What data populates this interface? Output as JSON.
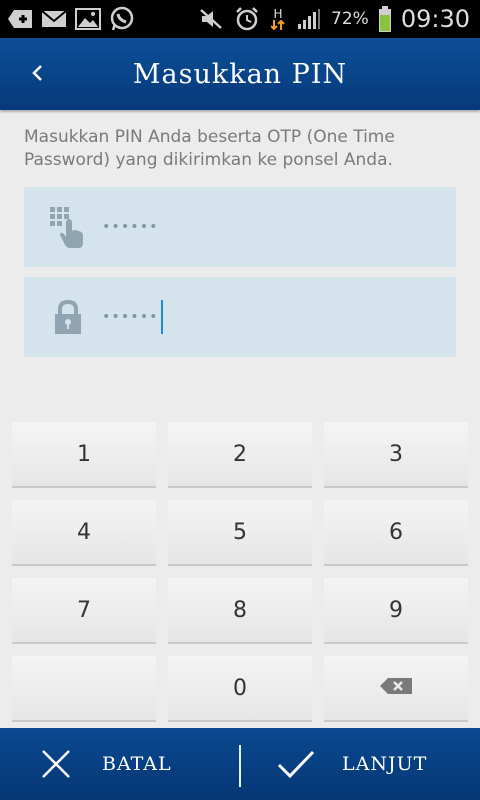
{
  "status_bar": {
    "battery_percent": "72%",
    "time": "09:30",
    "network_type": "H",
    "icons": [
      "plus-notification-icon",
      "email-icon",
      "gallery-icon",
      "whatsapp-icon",
      "mute-icon",
      "alarm-icon",
      "data-transfer-icon",
      "signal-icon",
      "battery-icon"
    ]
  },
  "header": {
    "title": "Masukkan PIN",
    "back_icon": "chevron-left-icon"
  },
  "instructions": "Masukkan PIN Anda beserta OTP (One Time Password) yang dikirimkan ke ponsel Anda.",
  "fields": {
    "otp": {
      "icon": "keypad-touch-icon",
      "value": "••••••"
    },
    "pin": {
      "icon": "lock-icon",
      "value": "••••••"
    }
  },
  "keypad": {
    "keys": [
      "1",
      "2",
      "3",
      "4",
      "5",
      "6",
      "7",
      "8",
      "9",
      "",
      "0",
      "backspace"
    ]
  },
  "footer": {
    "cancel_label": "BATAL",
    "next_label": "LANJUT",
    "cancel_icon": "close-icon",
    "next_icon": "checkmark-icon"
  },
  "colors": {
    "header": "#0c4f98",
    "field_bg": "#d4e3ec",
    "cursor": "#1a8fd8",
    "battery": "#8ac43f"
  }
}
